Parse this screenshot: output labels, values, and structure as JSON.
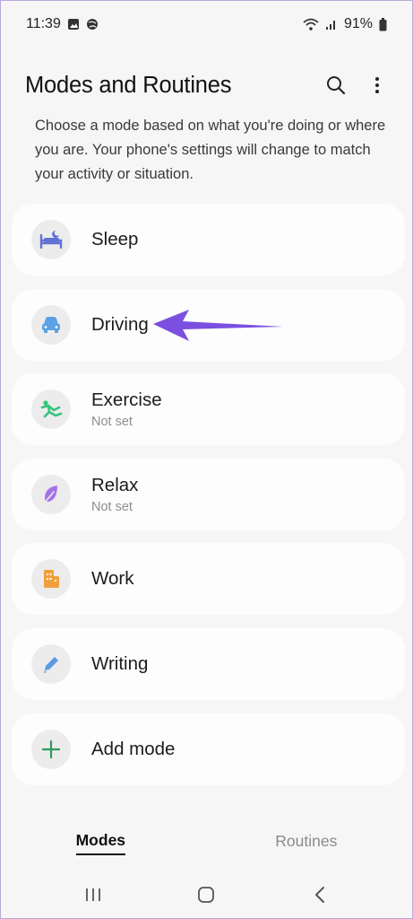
{
  "status_bar": {
    "time": "11:39",
    "battery": "91%",
    "left_icons": [
      "gallery-icon",
      "globe-icon"
    ],
    "right_icons": [
      "wifi-icon",
      "signal-icon",
      "battery-icon"
    ]
  },
  "header": {
    "title": "Modes and Routines",
    "actions": [
      "search-icon",
      "more-vert-icon"
    ]
  },
  "description": "Choose a mode based on what you're doing or where you are. Your phone's settings will change to match your activity or situation.",
  "modes": [
    {
      "label": "Sleep",
      "sublabel": "",
      "icon": "bed-icon",
      "color": "#6172d6"
    },
    {
      "label": "Driving",
      "sublabel": "",
      "icon": "car-icon",
      "color": "#5aa2e3"
    },
    {
      "label": "Exercise",
      "sublabel": "Not set",
      "icon": "running-icon",
      "color": "#33c67c"
    },
    {
      "label": "Relax",
      "sublabel": "Not set",
      "icon": "leaf-icon",
      "color": "#a273e6"
    },
    {
      "label": "Work",
      "sublabel": "",
      "icon": "building-icon",
      "color": "#f0a03c"
    },
    {
      "label": "Writing",
      "sublabel": "",
      "icon": "pencil-icon",
      "color": "#5a9be0"
    },
    {
      "label": "Add mode",
      "sublabel": "",
      "icon": "plus-icon",
      "color": "#2e9a5a"
    }
  ],
  "annotation": {
    "color": "#7b4fe0",
    "points_to": "Driving"
  },
  "tabs": [
    {
      "label": "Modes",
      "active": true
    },
    {
      "label": "Routines",
      "active": false
    }
  ],
  "nav": [
    "recents-icon",
    "home-icon",
    "back-icon"
  ]
}
